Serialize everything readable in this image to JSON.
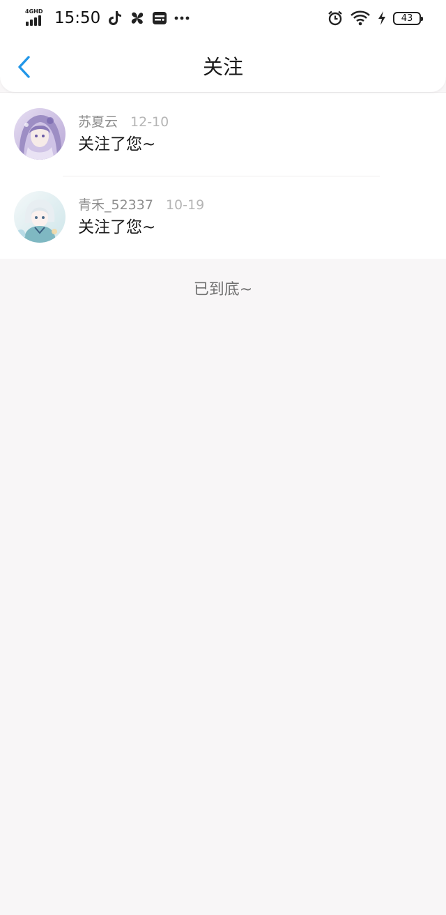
{
  "status_bar": {
    "network": "4GHD",
    "time": "15:50",
    "battery": "43",
    "icons": [
      "signal-icon",
      "tiktok-icon",
      "pinwheel-icon",
      "wallet-icon",
      "more-dots-icon",
      "alarm-icon",
      "wifi-icon",
      "charging-icon",
      "battery-icon"
    ]
  },
  "header": {
    "back_icon": "chevron-left-icon",
    "title": "关注"
  },
  "items": [
    {
      "name": "苏夏云",
      "date": "12-10",
      "message": "关注了您~",
      "avatar": "avatar-anime-girl-purple"
    },
    {
      "name": "青禾_52337",
      "date": "10-19",
      "message": "关注了您~",
      "avatar": "avatar-anime-boy-teal"
    }
  ],
  "footer": {
    "end_text": "已到底~"
  },
  "colors": {
    "accent": "#2196e8",
    "background": "#f8f6f7",
    "name_text": "#8e8e8e",
    "date_text": "#b5b5b5"
  }
}
